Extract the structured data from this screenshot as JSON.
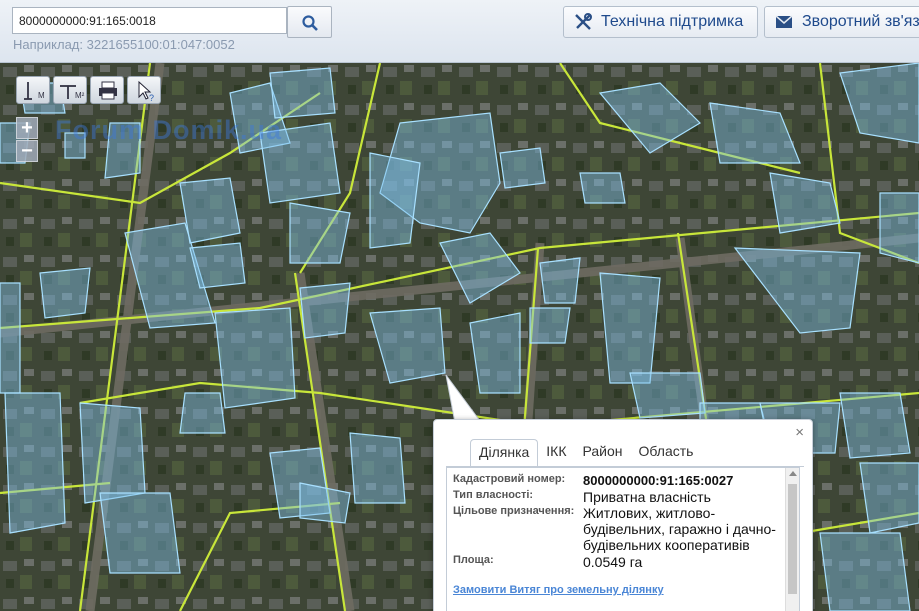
{
  "search": {
    "value": "8000000000:91:165:0018",
    "example": "Наприклад: 3221655100:01:047:0052"
  },
  "header": {
    "support_label": "Технічна підтримка",
    "feedback_label": "Зворотний зв'яз"
  },
  "watermark": "Forum Domik.ua",
  "map_tools": {
    "measure_label": "М",
    "area_label": "М²",
    "zoom_in": "+",
    "zoom_out": "−"
  },
  "popup": {
    "close": "×",
    "tabs": [
      "Ділянка",
      "ІКК",
      "Район",
      "Область"
    ],
    "active_tab": "Ділянка",
    "fields": [
      {
        "label": "Кадастровий номер:",
        "value": "8000000000:91:165:0027"
      },
      {
        "label": "Тип власності:",
        "value": "Приватна власність"
      },
      {
        "label": "Цільове призначення:",
        "value": "Житлових, житлово-будівельних, гаражно і дачно-будівельних кооперативів"
      },
      {
        "label": "Площа:",
        "value": "0.0549 га"
      }
    ],
    "link": "Замовити Витяг про земельну ділянку"
  },
  "colors": {
    "parcel_fill": "#7fbfe6",
    "parcel_stroke": "#a8e0ff",
    "district_line": "#c8e63a",
    "link": "#4a86d6",
    "button_text": "#1f4a8c"
  },
  "icons": [
    "search-icon",
    "tools-icon",
    "mail-icon",
    "ruler-icon",
    "area-ruler-icon",
    "print-icon",
    "info-pointer-icon",
    "close-icon"
  ]
}
